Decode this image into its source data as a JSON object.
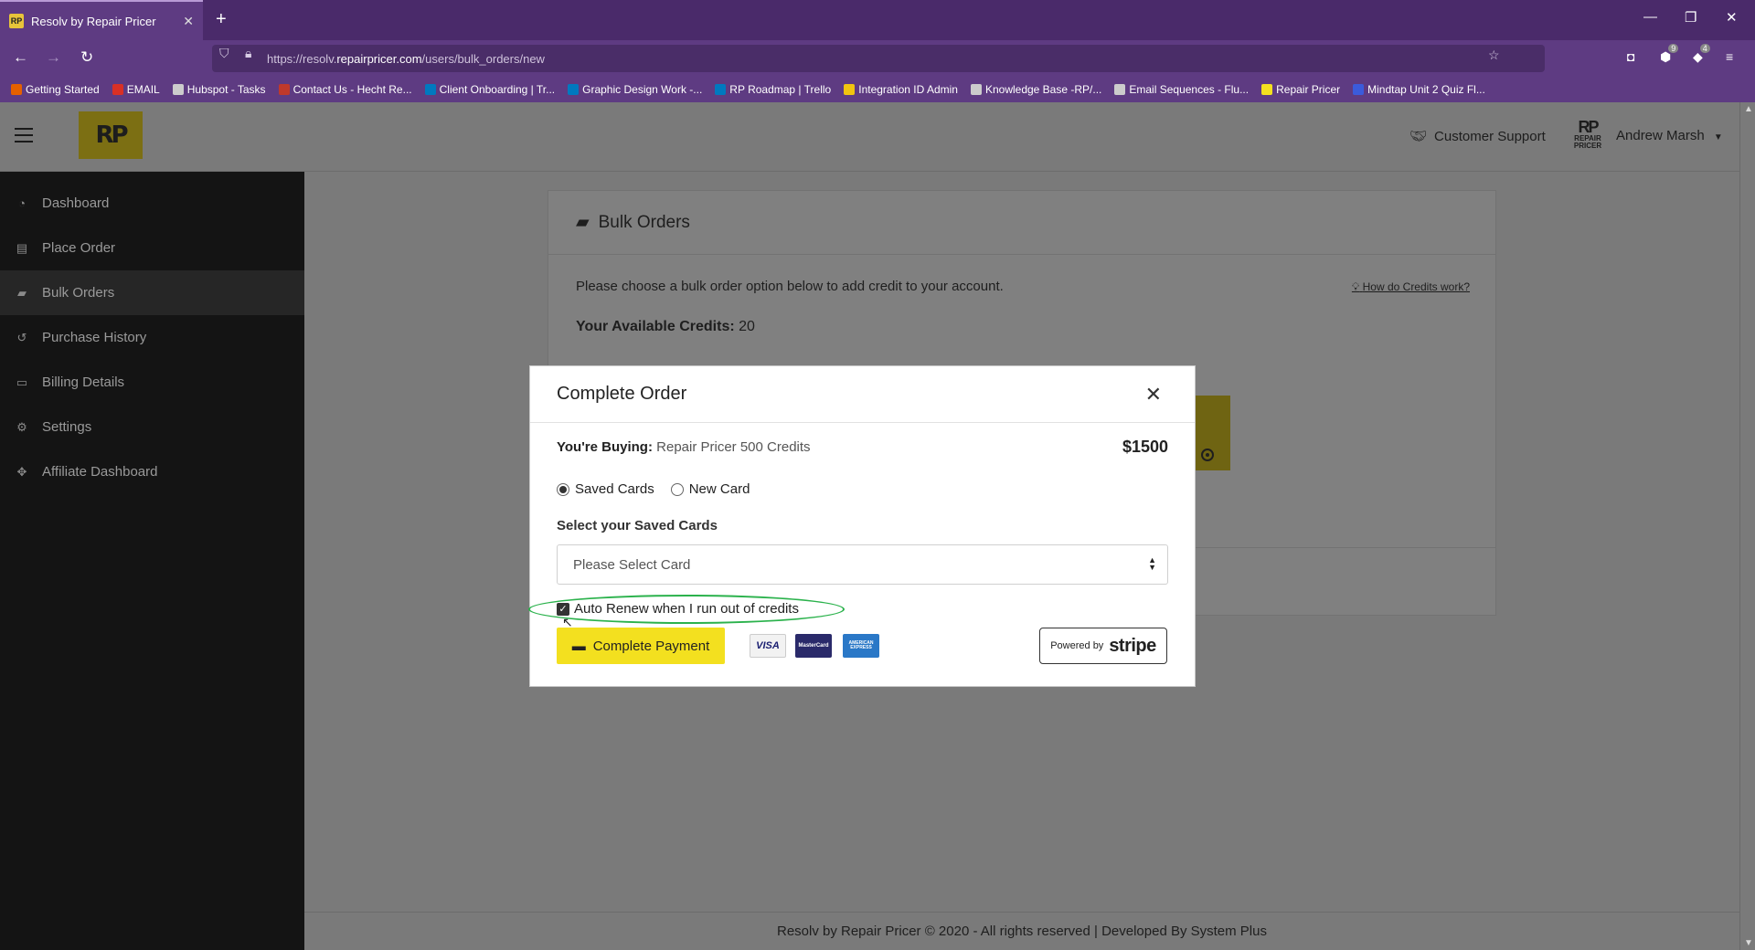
{
  "browser": {
    "tab_title": "Resolv by Repair Pricer",
    "url_prefix": "https://resolv.",
    "url_host": "repairpricer.com",
    "url_path": "/users/bulk_orders/new",
    "ext_badge_1": "9",
    "ext_badge_2": "4",
    "bookmarks": [
      {
        "label": "Getting Started",
        "color": "#e66000"
      },
      {
        "label": "EMAIL",
        "color": "#d93025"
      },
      {
        "label": "Hubspot - Tasks",
        "color": "#cccccc"
      },
      {
        "label": "Contact Us - Hecht Re...",
        "color": "#c0392b"
      },
      {
        "label": "Client Onboarding | Tr...",
        "color": "#0079bf"
      },
      {
        "label": "Graphic Design Work -...",
        "color": "#0079bf"
      },
      {
        "label": "RP Roadmap | Trello",
        "color": "#0079bf"
      },
      {
        "label": "Integration ID Admin",
        "color": "#f1c40f"
      },
      {
        "label": "Knowledge Base -RP/...",
        "color": "#cccccc"
      },
      {
        "label": "Email Sequences - Flu...",
        "color": "#cccccc"
      },
      {
        "label": "Repair Pricer",
        "color": "#f3e01f"
      },
      {
        "label": "Mindtap Unit 2 Quiz Fl...",
        "color": "#3b5bdb"
      }
    ]
  },
  "header": {
    "logo_text": "RP",
    "support_label": "Customer Support",
    "brand_mark": "RP",
    "brand_text": "REPAIR PRICER",
    "user_name": "Andrew Marsh"
  },
  "sidebar": {
    "items": [
      {
        "label": "Dashboard",
        "icon": "dashboard-icon",
        "glyph": "◔",
        "active": false
      },
      {
        "label": "Place Order",
        "icon": "clipboard-icon",
        "glyph": "▤",
        "active": false
      },
      {
        "label": "Bulk Orders",
        "icon": "boxes-icon",
        "glyph": "▰",
        "active": true
      },
      {
        "label": "Purchase History",
        "icon": "history-icon",
        "glyph": "↺",
        "active": false
      },
      {
        "label": "Billing Details",
        "icon": "credit-card-icon",
        "glyph": "▭",
        "active": false
      },
      {
        "label": "Settings",
        "icon": "gears-icon",
        "glyph": "⚙",
        "active": false
      },
      {
        "label": "Affiliate Dashboard",
        "icon": "handshake-icon",
        "glyph": "✥",
        "active": false
      }
    ]
  },
  "page": {
    "title": "Bulk Orders",
    "intro": "Please choose a bulk order option below to add credit to your account.",
    "help_link": "How do Credits work?",
    "credits_label": "Your Available Credits:",
    "credits_value": "20",
    "footer": "Resolv by Repair Pricer © 2020 - All rights reserved | Developed By System Plus"
  },
  "modal": {
    "title": "Complete Order",
    "buying_label": "You're Buying:",
    "product": "Repair Pricer 500 Credits",
    "price": "$1500",
    "radio_saved": "Saved Cards",
    "radio_new": "New Card",
    "selected_option": "Saved Cards",
    "select_label": "Select your Saved Cards",
    "select_value": "Please Select Card",
    "auto_renew_label": "Auto Renew when I run out of credits",
    "auto_renew_checked": true,
    "pay_button": "Complete Payment",
    "cards": {
      "visa": "VISA",
      "mastercard": "MasterCard",
      "amex": "AMERICAN EXPRESS"
    },
    "powered_by": "Powered by",
    "stripe": "stripe",
    "highlight_color": "#2bb24c"
  }
}
